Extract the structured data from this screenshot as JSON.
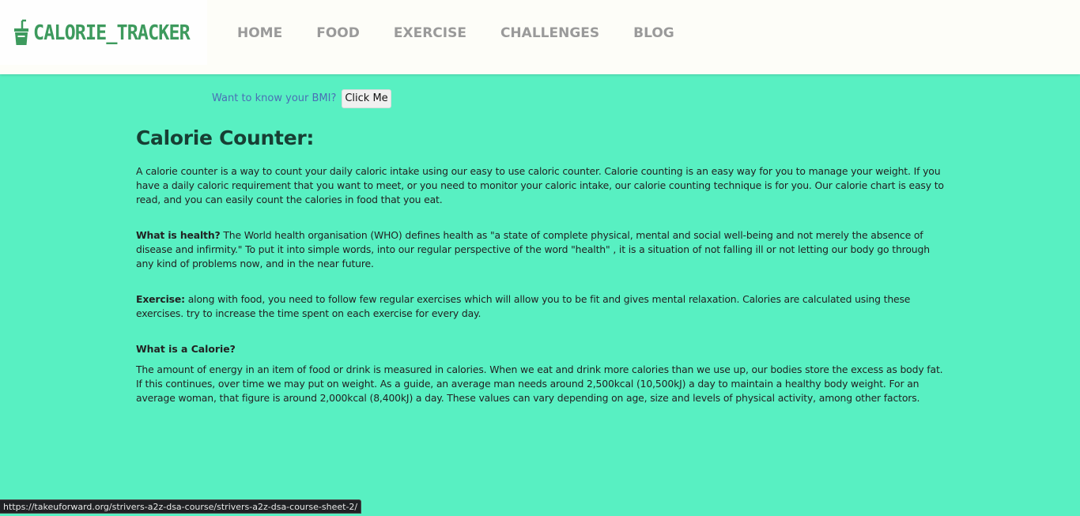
{
  "brand": {
    "name": "CALORIE_TRACKER",
    "icon": "cup-with-straw-icon",
    "color": "#3d9a5d"
  },
  "nav": {
    "items": [
      {
        "label": "HOME"
      },
      {
        "label": "FOOD"
      },
      {
        "label": "EXERCISE"
      },
      {
        "label": "CHALLENGES"
      },
      {
        "label": "BLOG"
      }
    ]
  },
  "bmi": {
    "question": "Want to know your BMI?",
    "button_label": "Click Me"
  },
  "main": {
    "title": "Calorie Counter:",
    "intro": "A calorie counter is a way to count your daily caloric intake using our easy to use caloric counter. Calorie counting is an easy way for you to manage your weight. If you have a daily caloric requirement that you want to meet, or you need to monitor your caloric intake, our calorie counting technique is for you. Our calorie chart is easy to read, and you can easily count the calories in food that you eat.",
    "health_label": "What is health?",
    "health_text": " The World health organisation (WHO) defines health as \"a state of complete physical, mental and social well-being and not merely the absence of disease and infirmity.\" To put it into simple words, into our regular perspective of the word \"health\" , it is a situation of not falling ill or not letting our body go through any kind of problems now, and in the near future.",
    "exercise_label": "Exercise:",
    "exercise_text": " along with food, you need to follow few regular exercises which will allow you to be fit and gives mental relaxation. Calories are calculated using these exercises. try to increase the time spent on each exercise for every day.",
    "calorie_heading": "What is a Calorie?",
    "calorie_text": "The amount of energy in an item of food or drink is measured in calories. When we eat and drink more calories than we use up, our bodies store the excess as body fat. If this continues, over time we may put on weight. As a guide, an average man needs around 2,500kcal (10,500kJ) a day to maintain a healthy body weight. For an average woman, that figure is around 2,000kcal (8,400kJ) a day. These values can vary depending on age, size and levels of physical activity, among other factors."
  },
  "status_bar": {
    "url": "https://takeuforward.org/strivers-a2z-dsa-course/strivers-a2z-dsa-course-sheet-2/"
  },
  "colors": {
    "background": "#58f0c2",
    "navbar": "#fdfdf8",
    "nav_text": "#9a9a9a",
    "title": "#173f34",
    "link_text": "#4a6fb5"
  }
}
